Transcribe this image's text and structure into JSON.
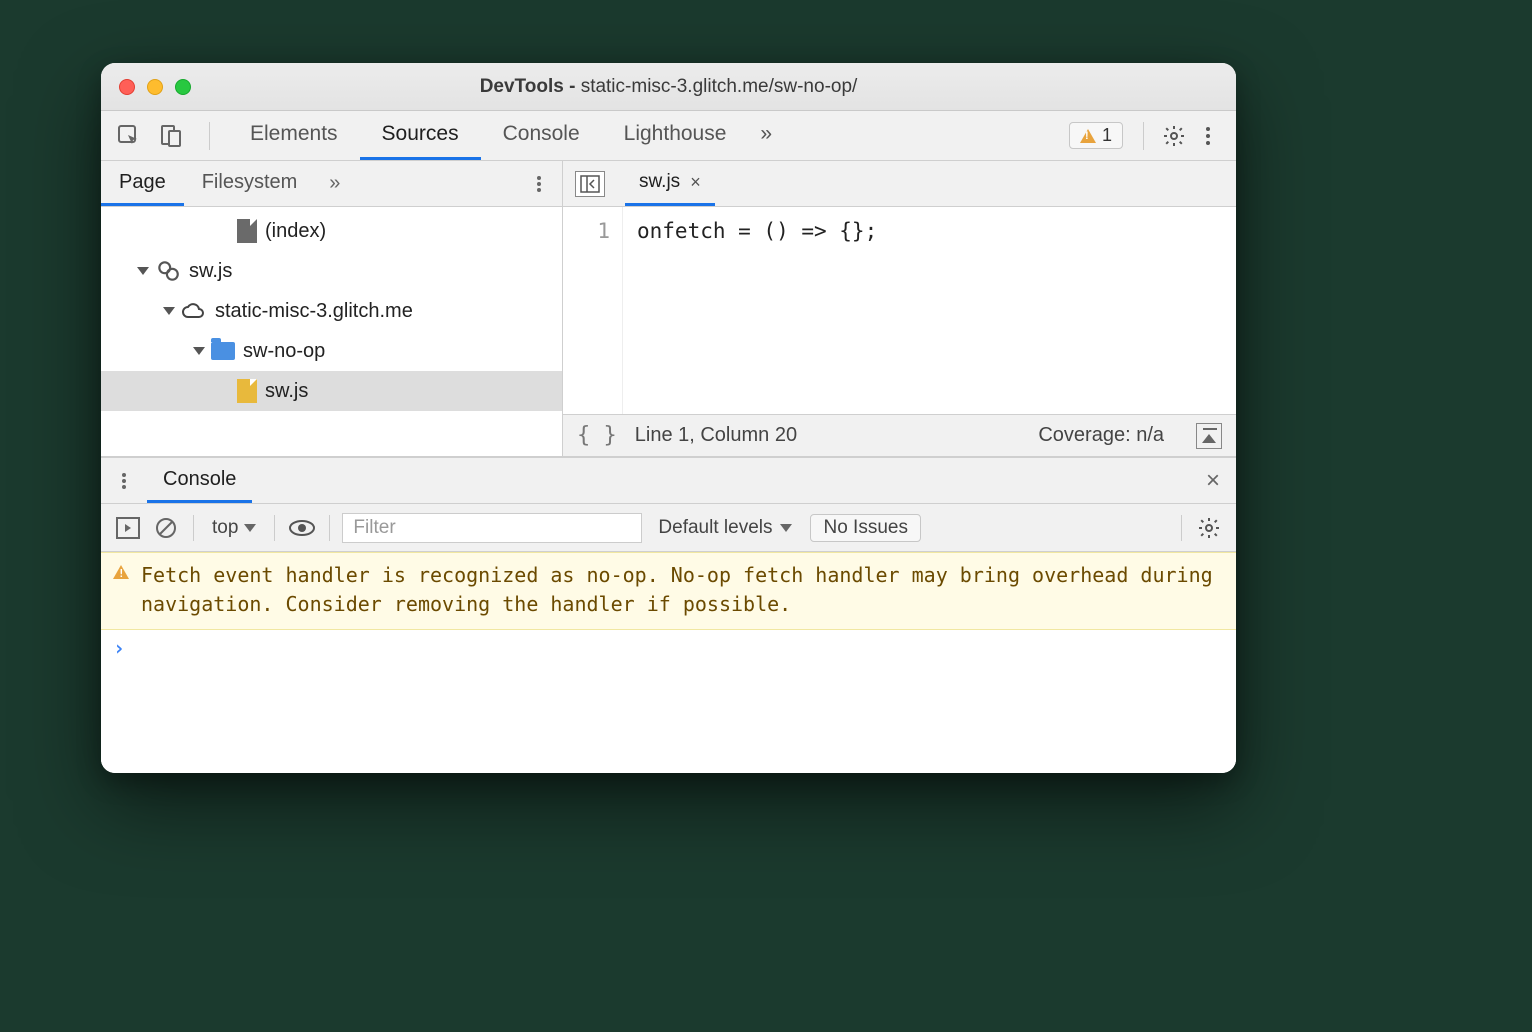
{
  "window": {
    "title_prefix": "DevTools - ",
    "title_path": "static-misc-3.glitch.me/sw-no-op/"
  },
  "mainTabs": {
    "items": [
      "Elements",
      "Sources",
      "Console",
      "Lighthouse"
    ],
    "activeIndex": 1,
    "overflow": "»",
    "warningCount": "1"
  },
  "navigator": {
    "tabs": [
      "Page",
      "Filesystem"
    ],
    "activeIndex": 0,
    "overflow": "»",
    "tree": {
      "indexLabel": "(index)",
      "swWorker": "sw.js",
      "origin": "static-misc-3.glitch.me",
      "folder": "sw-no-op",
      "file": "sw.js"
    }
  },
  "editor": {
    "tabName": "sw.js",
    "lineNumber": "1",
    "code": "onfetch = () => {};",
    "status": {
      "position": "Line 1, Column 20",
      "coverage": "Coverage: n/a"
    }
  },
  "drawer": {
    "tab": "Console"
  },
  "consoleToolbar": {
    "context": "top",
    "filterPlaceholder": "Filter",
    "levels": "Default levels",
    "issues": "No Issues"
  },
  "consoleMsg": {
    "text": "Fetch event handler is recognized as no-op. No-op fetch handler may bring overhead during navigation. Consider removing the handler if possible."
  }
}
